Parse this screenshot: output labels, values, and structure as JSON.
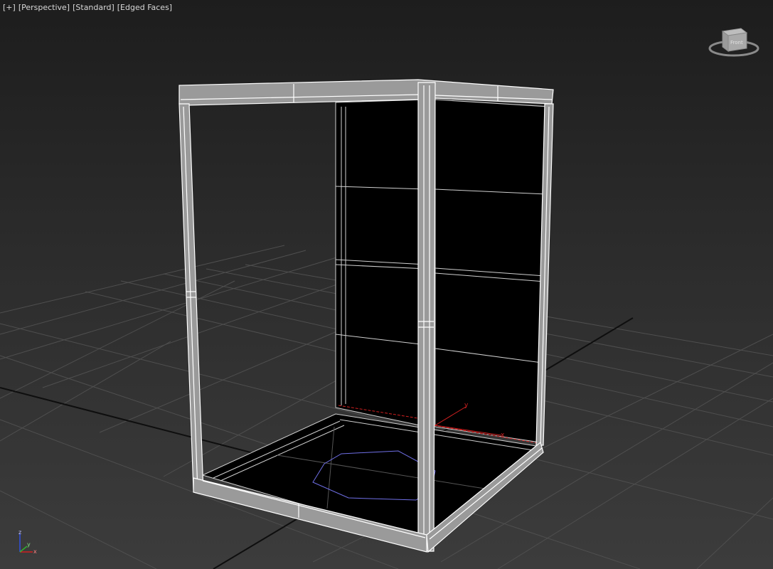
{
  "viewport": {
    "label_plus": "[+]",
    "label_view": "[Perspective]",
    "label_shading": "[Standard]",
    "label_mode": "[Edged Faces]"
  },
  "viewcube": {
    "face_label": "Front"
  },
  "axis_tripod": {
    "x": "x",
    "y": "y",
    "z": "z"
  },
  "gizmo": {
    "x": "x",
    "y": "y"
  },
  "colors": {
    "background_top": "#1d1d1d",
    "background_bottom": "#3c3c3c",
    "grid": "#4f4f4f",
    "grid_major": "#111111",
    "frame_fill": "#9a9a9a",
    "frame_edge": "#ffffff",
    "panel_fill": "#000000",
    "selection": "#7070ff",
    "axis_x": "#d02020",
    "axis_y": "#30b030",
    "axis_z": "#3050e0"
  }
}
